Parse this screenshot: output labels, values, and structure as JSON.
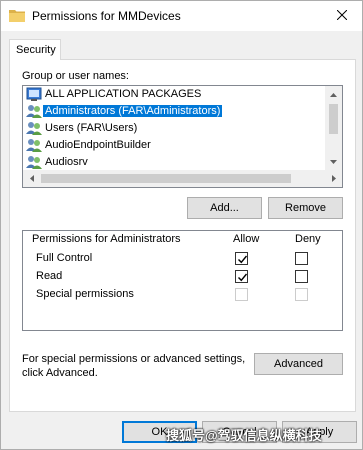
{
  "window": {
    "title": "Permissions for MMDevices"
  },
  "tabs": [
    {
      "label": "Security",
      "selected": true
    }
  ],
  "group_section": {
    "label": "Group or user names:",
    "items": [
      {
        "label": "ALL APPLICATION PACKAGES",
        "icon": "packages-icon",
        "selected": false
      },
      {
        "label": "Administrators (FAR\\Administrators)",
        "icon": "user-group-icon",
        "selected": true
      },
      {
        "label": "Users (FAR\\Users)",
        "icon": "user-group-icon",
        "selected": false
      },
      {
        "label": "AudioEndpointBuilder",
        "icon": "user-group-icon",
        "selected": false
      },
      {
        "label": "Audiosrv",
        "icon": "user-group-icon",
        "selected": false
      }
    ],
    "add_label": "Add...",
    "remove_label": "Remove"
  },
  "permissions": {
    "header": "Permissions for Administrators",
    "allow_label": "Allow",
    "deny_label": "Deny",
    "rows": [
      {
        "name": "Full Control",
        "allow": true,
        "deny": false,
        "enabled": true
      },
      {
        "name": "Read",
        "allow": true,
        "deny": false,
        "enabled": true
      },
      {
        "name": "Special permissions",
        "allow": false,
        "deny": false,
        "enabled": false
      }
    ]
  },
  "advanced": {
    "note": "For special permissions or advanced settings, click Advanced.",
    "button_label": "Advanced"
  },
  "footer": {
    "ok_label": "OK",
    "cancel_label": "Cancel",
    "apply_label": "Apply"
  },
  "watermark": "搜狐号@驾驭信息纵横科技",
  "colors": {
    "selection": "#0078d7",
    "default_border": "#0078d7"
  }
}
